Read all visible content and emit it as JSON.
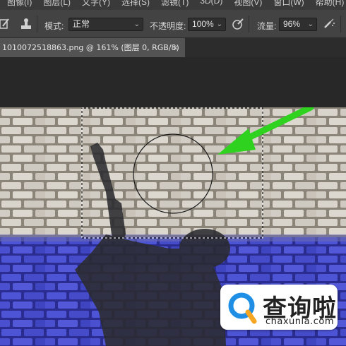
{
  "menu": {
    "items": [
      "图像(I)",
      "图层(L)",
      "文字(Y)",
      "选择(S)",
      "滤镜(T)",
      "3D(D)",
      "视图(V)",
      "窗口(W)",
      "帮助(H)"
    ]
  },
  "options": {
    "mode_label": "模式:",
    "mode_value": "正常",
    "opacity_label": "不透明度:",
    "opacity_value": "100%",
    "flow_label": "流量:",
    "flow_value": "96%"
  },
  "tab": {
    "title": "1010072518863.png @ 161% (图层 0, RGB/8)",
    "close": "×"
  },
  "watermark": {
    "brand": "查询啦",
    "domain": "chaxunla.com"
  },
  "colors": {
    "accent_arrow": "#2fd21f",
    "brick_tint": "#3a3fc4",
    "badge_blue": "#1f8fe6",
    "badge_orange": "#f5a623"
  }
}
